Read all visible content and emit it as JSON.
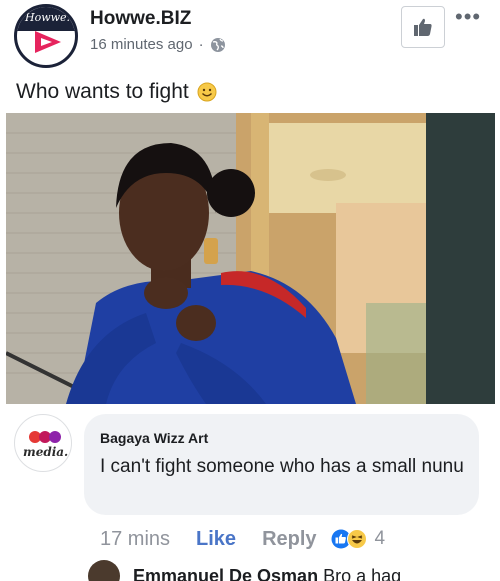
{
  "post": {
    "page_name": "Howwe.BIZ",
    "time": "16 minutes ago",
    "separator": "·",
    "text": "Who wants to fight",
    "logo_text": "Howwe."
  },
  "comment": {
    "author": "Bagaya Wizz Art",
    "text": "I can't fight someone who has a small nunu",
    "time": "17 mins",
    "like_label": "Like",
    "reply_label": "Reply",
    "reaction_count": "4",
    "avatar_text": "media."
  },
  "next_comment": {
    "author": "Emmanuel De Osman",
    "text": "Bro a hag"
  },
  "colors": {
    "link_blue": "#4a75c7",
    "muted": "#90949c",
    "bubble": "#f0f2f5"
  },
  "icons": [
    "globe-icon",
    "thumbs-up-icon",
    "more-icon",
    "smile-emoji-icon",
    "like-reaction-icon",
    "haha-reaction-icon",
    "play-icon"
  ]
}
